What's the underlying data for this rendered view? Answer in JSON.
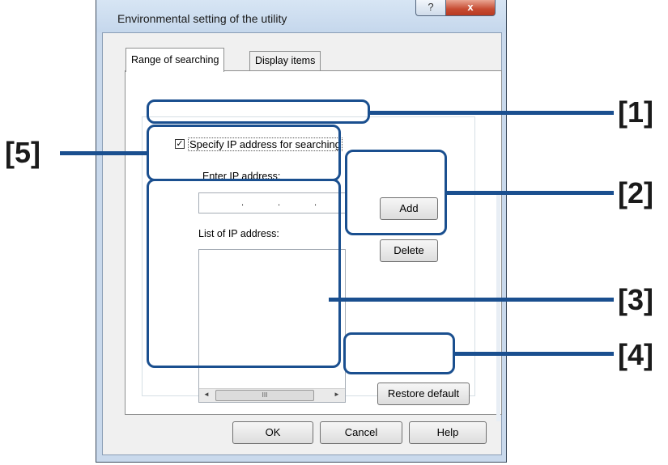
{
  "dialog": {
    "title": "Environmental setting of the utility",
    "help_glyph": "?",
    "close_glyph": "x"
  },
  "tabs": [
    {
      "label": "Range of searching",
      "active": true
    },
    {
      "label": "Display items",
      "active": false
    }
  ],
  "range": {
    "specify_checkbox_label": "Specify IP address for searching",
    "specify_checked": true,
    "check_glyph": "✓",
    "enter_ip_label": "Enter IP address:",
    "ip_value": [
      "",
      "",
      "",
      ""
    ],
    "ip_separator": ".",
    "add_label": "Add",
    "delete_label": "Delete",
    "list_label": "List of IP address:",
    "list_items": [],
    "restore_label": "Restore default"
  },
  "scrollbar": {
    "left_arrow": "◄",
    "right_arrow": "►",
    "thumb_grip": "III"
  },
  "footer": {
    "ok_label": "OK",
    "cancel_label": "Cancel",
    "help_label": "Help"
  },
  "callouts": {
    "c1": "[1]",
    "c2": "[2]",
    "c3": "[3]",
    "c4": "[4]",
    "c5": "[5]"
  },
  "colors": {
    "callout_accent": "#1a4f8f",
    "close_button": "#c64a31",
    "title_bar": "#c9d9ec"
  }
}
